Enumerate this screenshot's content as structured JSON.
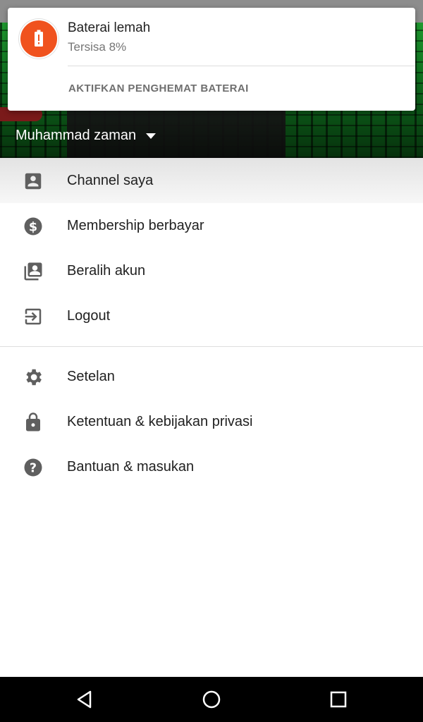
{
  "notification": {
    "title": "Baterai lemah",
    "subtitle": "Tersisa 8%",
    "action": "AKTIFKAN PENGHEMAT BATERAI",
    "accent": "#f0521e"
  },
  "header": {
    "account_name": "Muhammad zaman"
  },
  "menu": {
    "group1": [
      {
        "label": "Channel saya",
        "icon": "account-box-icon"
      },
      {
        "label": "Membership berbayar",
        "icon": "dollar-circle-icon"
      },
      {
        "label": "Beralih akun",
        "icon": "switch-account-icon"
      },
      {
        "label": "Logout",
        "icon": "logout-icon"
      }
    ],
    "group2": [
      {
        "label": "Setelan",
        "icon": "gear-icon"
      },
      {
        "label": "Ketentuan & kebijakan privasi",
        "icon": "lock-icon"
      },
      {
        "label": "Bantuan & masukan",
        "icon": "help-icon"
      }
    ]
  },
  "navbar": {
    "buttons": [
      "back-icon",
      "home-icon",
      "recents-icon"
    ]
  }
}
